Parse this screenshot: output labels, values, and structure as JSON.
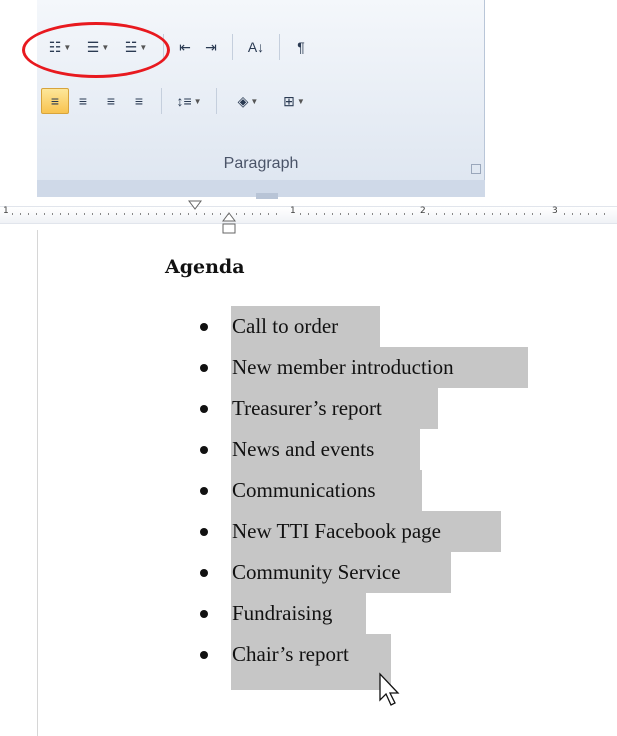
{
  "ribbon": {
    "group_label": "Paragraph",
    "row1": [
      {
        "name": "bullets-button",
        "icon": "bullet-list-icon",
        "glyph": "☷",
        "dropdown": true
      },
      {
        "name": "numbering-button",
        "icon": "numbered-list-icon",
        "glyph": "☰",
        "dropdown": true
      },
      {
        "name": "multilevel-list-button",
        "icon": "multilevel-list-icon",
        "glyph": "☱",
        "dropdown": true
      },
      {
        "name": "decrease-indent-button",
        "icon": "decrease-indent-icon",
        "glyph": "⇤"
      },
      {
        "name": "increase-indent-button",
        "icon": "increase-indent-icon",
        "glyph": "⇥"
      },
      {
        "name": "sort-button",
        "icon": "sort-az-icon",
        "glyph": "A↓"
      },
      {
        "name": "show-hide-button",
        "icon": "pilcrow-icon",
        "glyph": "¶"
      }
    ],
    "row2": [
      {
        "name": "align-left-button",
        "icon": "align-left-icon",
        "glyph": "≡",
        "active": true
      },
      {
        "name": "center-button",
        "icon": "align-center-icon",
        "glyph": "≡"
      },
      {
        "name": "align-right-button",
        "icon": "align-right-icon",
        "glyph": "≡"
      },
      {
        "name": "justify-button",
        "icon": "justify-icon",
        "glyph": "≡"
      },
      {
        "name": "line-spacing-button",
        "icon": "line-spacing-icon",
        "glyph": "↕≡",
        "dropdown": true
      },
      {
        "name": "shading-button",
        "icon": "paint-bucket-icon",
        "glyph": "◈",
        "dropdown": true
      },
      {
        "name": "borders-button",
        "icon": "borders-icon",
        "glyph": "⊞",
        "dropdown": true
      }
    ]
  },
  "ruler": {
    "numbers": [
      "1",
      "1",
      "2",
      "3"
    ]
  },
  "document": {
    "heading": "Agenda",
    "items": [
      "Call to order",
      "New member introduction",
      "Treasurer’s report",
      "News and events",
      "Communications",
      "New TTI Facebook page",
      "Community Service",
      "Fundraising",
      "Chair’s report"
    ]
  },
  "colors": {
    "selection": "#c6c6c6",
    "highlight_ellipse": "#e8191f",
    "active_button": "#f8c34f"
  }
}
